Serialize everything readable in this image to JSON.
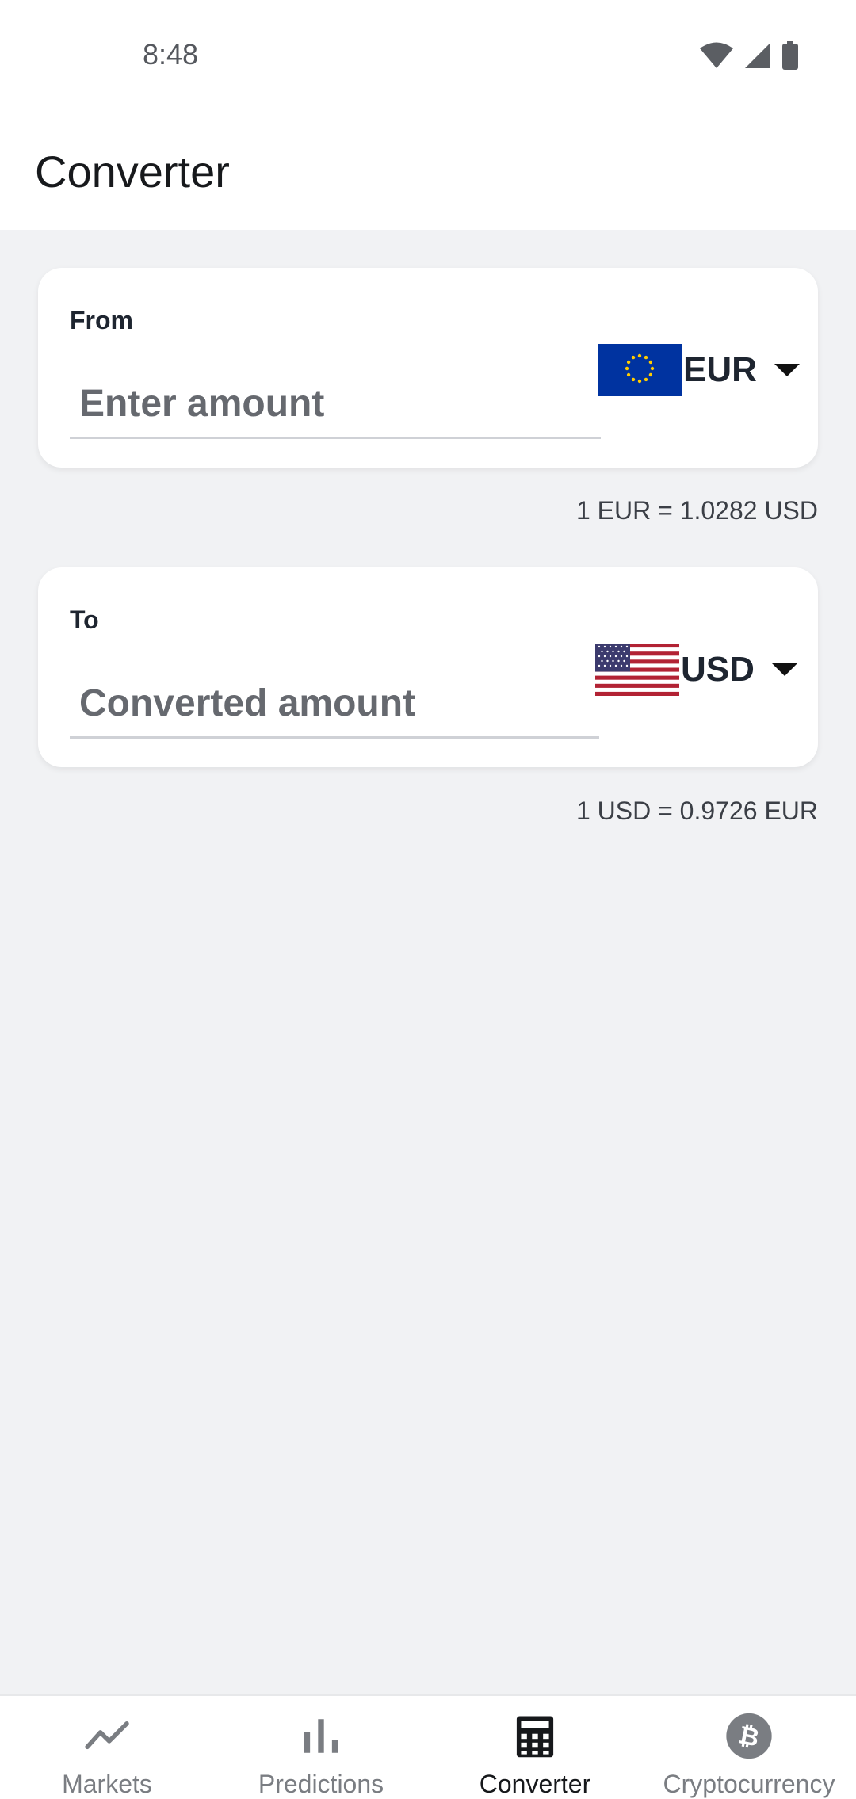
{
  "status_bar": {
    "time": "8:48",
    "icons": [
      "wifi-icon",
      "cellular-signal-icon",
      "battery-icon"
    ]
  },
  "app_bar": {
    "title": "Converter"
  },
  "from_card": {
    "label": "From",
    "amount_value": "",
    "amount_placeholder": "Enter amount",
    "currency_code": "EUR",
    "flag_icon": "eu-flag-icon"
  },
  "from_rate": "1 EUR = 1.0282 USD",
  "to_card": {
    "label": "To",
    "amount_value": "",
    "amount_placeholder": "Converted amount",
    "currency_code": "USD",
    "flag_icon": "us-flag-icon"
  },
  "to_rate": "1 USD = 0.9726 EUR",
  "bottom_nav": {
    "items": [
      {
        "label": "Markets",
        "icon": "trending-line-icon",
        "active": false
      },
      {
        "label": "Predictions",
        "icon": "bar-chart-icon",
        "active": false
      },
      {
        "label": "Converter",
        "icon": "calculator-icon",
        "active": true
      },
      {
        "label": "Cryptocurrency",
        "icon": "bitcoin-icon",
        "active": false
      }
    ]
  },
  "colors": {
    "background": "#f1f2f4",
    "card": "#ffffff",
    "active_nav": "#16181b",
    "inactive_nav": "#7a7d82",
    "eu_blue": "#0033a0",
    "eu_star": "#ffcc00",
    "us_red": "#b22234",
    "us_blue": "#3c3b6e"
  }
}
